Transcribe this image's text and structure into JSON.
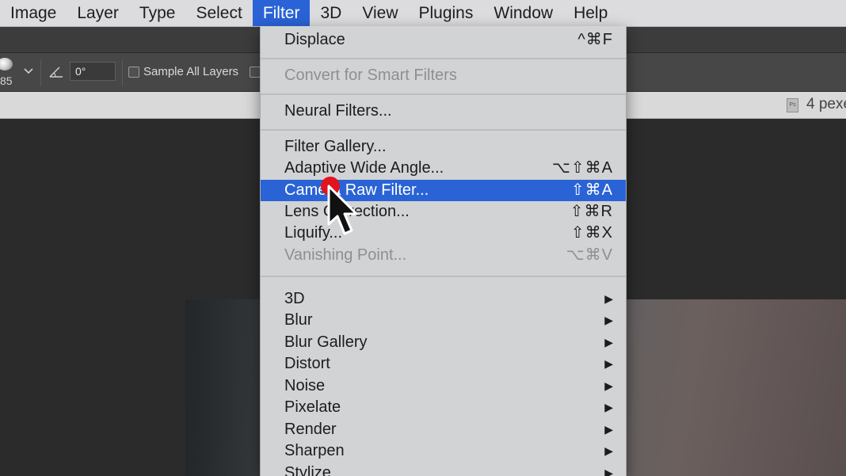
{
  "menubar": {
    "items": [
      {
        "label": "Image"
      },
      {
        "label": "Layer"
      },
      {
        "label": "Type"
      },
      {
        "label": "Select"
      },
      {
        "label": "Filter",
        "active": true
      },
      {
        "label": "3D"
      },
      {
        "label": "View"
      },
      {
        "label": "Plugins"
      },
      {
        "label": "Window"
      },
      {
        "label": "Help"
      }
    ]
  },
  "options_bar": {
    "brush_size": "85",
    "angle_value": "0°",
    "sample_all_layers_label": "Sample All Layers",
    "sample_all_layers_checked": false
  },
  "document_tab": {
    "icon_text": "Ps",
    "title": "4 pexe"
  },
  "filter_menu": {
    "items": [
      {
        "label": "Displace",
        "shortcut": "^⌘F"
      },
      {
        "label": "Convert for Smart Filters",
        "disabled": true
      },
      {
        "label": "Neural Filters..."
      },
      {
        "label": "Filter Gallery..."
      },
      {
        "label": "Adaptive Wide Angle...",
        "shortcut": "⌥⇧⌘A"
      },
      {
        "label": "Camera Raw Filter...",
        "shortcut": "⇧⌘A",
        "highlighted": true
      },
      {
        "label": "Lens Correction...",
        "shortcut": "⇧⌘R"
      },
      {
        "label": "Liquify...",
        "shortcut": "⇧⌘X"
      },
      {
        "label": "Vanishing Point...",
        "shortcut": "⌥⌘V",
        "disabled": true
      },
      {
        "label": "3D",
        "submenu": true
      },
      {
        "label": "Blur",
        "submenu": true
      },
      {
        "label": "Blur Gallery",
        "submenu": true
      },
      {
        "label": "Distort",
        "submenu": true
      },
      {
        "label": "Noise",
        "submenu": true
      },
      {
        "label": "Pixelate",
        "submenu": true
      },
      {
        "label": "Render",
        "submenu": true
      },
      {
        "label": "Sharpen",
        "submenu": true
      },
      {
        "label": "Stylize",
        "submenu": true
      }
    ],
    "submenu_arrow": "▶"
  },
  "colors": {
    "highlight": "#2a63d6",
    "cursor_click_marker": "#e0141f"
  },
  "icons": [
    "brush-preview-icon",
    "chevron-down-icon",
    "angle-icon",
    "photoshop-doc-icon",
    "submenu-arrow-icon",
    "mouse-pointer-icon"
  ]
}
